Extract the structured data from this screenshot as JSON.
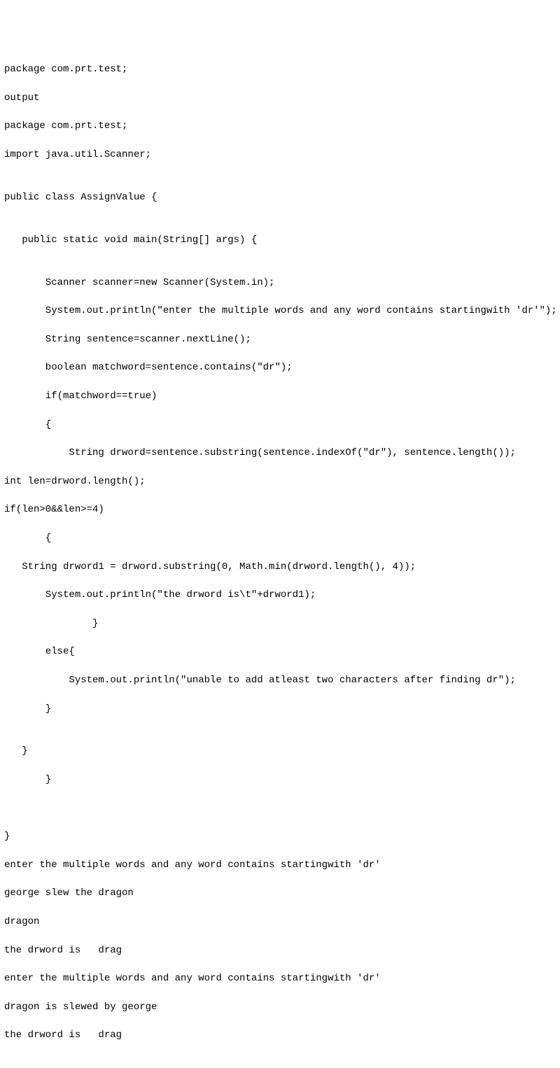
{
  "code": {
    "l1": "package com.prt.test;",
    "l2": "output",
    "l3": "package com.prt.test;",
    "l4": "import java.util.Scanner;",
    "l5": "",
    "l6": "public class AssignValue {",
    "l7": "",
    "l8": "   public static void main(String[] args) {",
    "l9": "",
    "l10": "       Scanner scanner=new Scanner(System.in);",
    "l11": "       System.out.println(\"enter the multiple words and any word contains startingwith 'dr'\");",
    "l12": "       String sentence=scanner.nextLine();",
    "l13": "       boolean matchword=sentence.contains(\"dr\");",
    "l14": "       if(matchword==true)",
    "l15": "       {",
    "l16": "           String drword=sentence.substring(sentence.indexOf(\"dr\"), sentence.length());",
    "l17": "int len=drword.length();",
    "l18": "if(len>0&&len>=4)",
    "l19": "       {",
    "l20": "   String drword1 = drword.substring(0, Math.min(drword.length(), 4));",
    "l21": "       System.out.println(\"the drword is\\t\"+drword1);",
    "l22": "               }",
    "l23": "       else{",
    "l24": "           System.out.println(\"unable to add atleast two characters after finding dr\");",
    "l25": "       }",
    "l26": "",
    "l27": "   }",
    "l28": "       }",
    "l29": "",
    "l30": "",
    "l31": "}",
    "l32": "enter the multiple words and any word contains startingwith 'dr'",
    "l33": "george slew the dragon",
    "l34": "dragon",
    "l35": "the drword is   drag",
    "l36": "enter the multiple words and any word contains startingwith 'dr'",
    "l37": "dragon is slewed by george",
    "l38": "the drword is   drag"
  }
}
